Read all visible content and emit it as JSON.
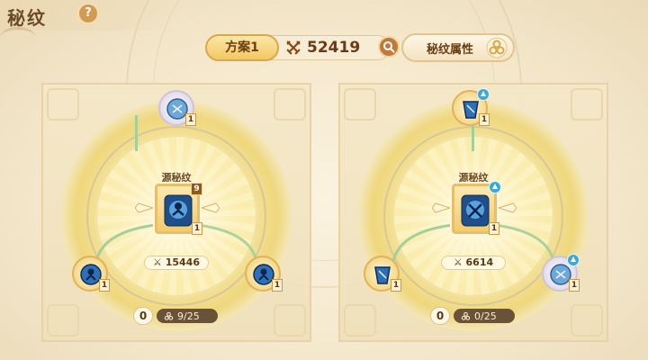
{
  "header": {
    "title": "秘纹",
    "help_label": "?"
  },
  "toolbar": {
    "plan_label": "方案1",
    "power_value": "52419",
    "attributes_label": "秘纹属性"
  },
  "panels": [
    {
      "center_label": "源秘纹",
      "center_level": "9",
      "center_count": "1",
      "center_power": "15446",
      "top_count": "1",
      "left_count": "1",
      "right_count": "1",
      "zero_label": "0",
      "progress_text": "9/25",
      "progress_value": 0.36
    },
    {
      "center_label": "源秘纹",
      "center_count": "1",
      "center_power": "6614",
      "top_count": "1",
      "left_count": "1",
      "right_count": "1",
      "zero_label": "0",
      "progress_text": "0/25",
      "progress_value": 0
    }
  ],
  "colors": {
    "accent_gold": "#f3c862",
    "text_brown": "#6b3a14",
    "link_green": "#a3cf9b",
    "upgrade_blue": "#3aa9d6"
  }
}
